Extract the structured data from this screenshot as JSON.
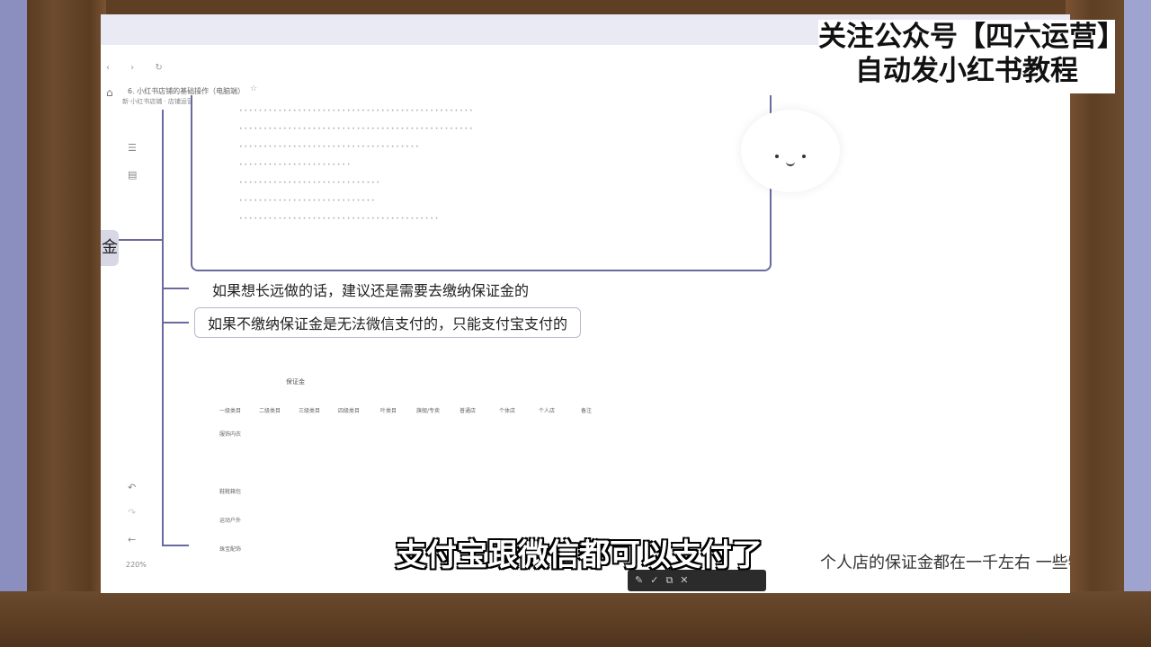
{
  "watermark": {
    "line1": "关注公众号【四六运营】",
    "line2": "自动发小红书教程"
  },
  "browser": {
    "nav": "‹ › ↻",
    "doc_title": "6. 小红书店铺的基础操作（电脑端）",
    "doc_sub": "新·小红书店铺 · 店铺运营教程"
  },
  "mindmap": {
    "root_label": "金",
    "nodes": [
      "如果想长远做的话，建议还是需要去缴纳保证金的",
      "如果不缴纳保证金是无法微信支付的，只能支付宝支付的"
    ]
  },
  "deposit_table": {
    "title": "保证金",
    "headers": [
      "一级类目",
      "二级类目",
      "三级类目",
      "四级类目",
      "叶类目",
      "旗舰/专卖",
      "普通店",
      "个体店",
      "个人店",
      "备注"
    ],
    "rows": [
      [
        "服饰内衣",
        "",
        "",
        "",
        "",
        "",
        "",
        "",
        "",
        ""
      ],
      [
        "",
        "",
        "",
        "",
        "",
        "",
        "",
        "",
        "",
        ""
      ],
      [
        "鞋靴箱包",
        "",
        "",
        "",
        "",
        "",
        "",
        "",
        "",
        ""
      ],
      [
        "运动户外",
        "",
        "",
        "",
        "",
        "",
        "",
        "",
        "",
        ""
      ],
      [
        "珠宝配饰",
        "",
        "",
        "",
        "",
        "",
        "",
        "",
        "",
        ""
      ]
    ]
  },
  "sidebar": {
    "zoom": "220%"
  },
  "subtitle": {
    "main": "支付宝跟微信都可以支付了",
    "secondary": "个人店的保证金都在一千左右 一些特殊的"
  },
  "colors": {
    "frame": "#6b4a2e",
    "tree_line": "#6a6aa0",
    "background": "#9ea3cf"
  }
}
